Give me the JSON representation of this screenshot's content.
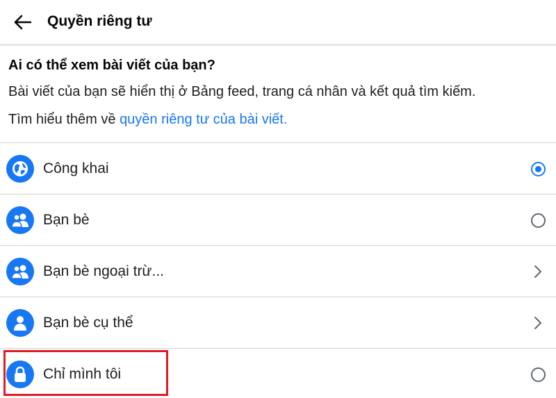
{
  "header": {
    "title": "Quyền riêng tư",
    "back_icon": "arrow-left-icon"
  },
  "intro": {
    "heading": "Ai có thể xem bài viết của bạn?",
    "description": "Bài viết của bạn sẽ hiển thị ở Bảng feed, trang cá nhân và kết quả tìm kiếm.",
    "learn_prefix": "Tìm hiểu thêm về ",
    "learn_link": "quyền riêng tư của bài viết."
  },
  "options": [
    {
      "label": "Công khai",
      "icon": "globe-icon",
      "control": "radio",
      "selected": true
    },
    {
      "label": "Bạn bè",
      "icon": "friends-icon",
      "control": "radio",
      "selected": false
    },
    {
      "label": "Bạn bè ngoại trừ...",
      "icon": "friends-icon",
      "control": "chevron",
      "selected": false
    },
    {
      "label": "Bạn bè cụ thể",
      "icon": "person-icon",
      "control": "chevron",
      "selected": false
    },
    {
      "label": "Chỉ mình tôi",
      "icon": "lock-icon",
      "control": "radio",
      "selected": false
    }
  ],
  "colors": {
    "accent": "#1877f2",
    "highlight": "#e01b24",
    "divider": "#d4d4d4"
  }
}
